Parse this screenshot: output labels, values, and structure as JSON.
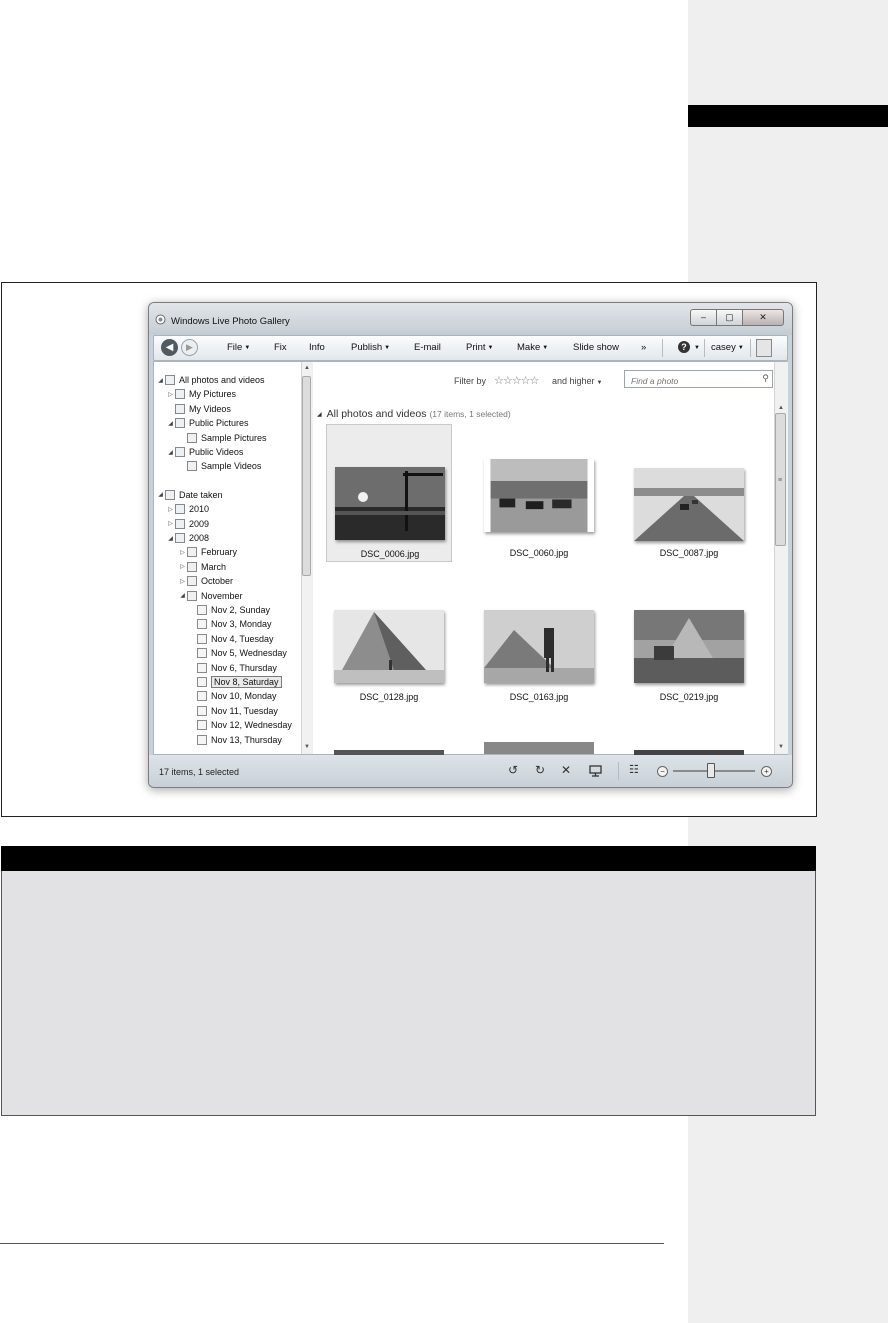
{
  "window": {
    "title": "Windows Live Photo Gallery",
    "controls": [
      "–",
      "▢",
      "✕"
    ]
  },
  "toolbar": {
    "menus": [
      {
        "label": "File",
        "dropdown": true
      },
      {
        "label": "Fix",
        "dropdown": false
      },
      {
        "label": "Info",
        "dropdown": false
      },
      {
        "label": "Publish",
        "dropdown": true
      },
      {
        "label": "E-mail",
        "dropdown": false
      },
      {
        "label": "Print",
        "dropdown": true
      },
      {
        "label": "Make",
        "dropdown": true
      },
      {
        "label": "Slide show",
        "dropdown": false
      }
    ],
    "overflow_label": "»",
    "help_label": "?",
    "user_label": "casey"
  },
  "nav_tree": {
    "items": [
      {
        "label": "All photos and videos",
        "level": 0,
        "toggle": "expanded",
        "icon": "library-icon"
      },
      {
        "label": "My Pictures",
        "level": 1,
        "toggle": "collapsed",
        "icon": "folder-icon"
      },
      {
        "label": "My Videos",
        "level": 1,
        "toggle": "none",
        "icon": "folder-icon"
      },
      {
        "label": "Public Pictures",
        "level": 1,
        "toggle": "expanded",
        "icon": "folder-icon"
      },
      {
        "label": "Sample Pictures",
        "level": 2,
        "toggle": "none",
        "icon": "folder-icon"
      },
      {
        "label": "Public Videos",
        "level": 1,
        "toggle": "expanded",
        "icon": "folder-icon"
      },
      {
        "label": "Sample Videos",
        "level": 2,
        "toggle": "none",
        "icon": "folder-icon"
      },
      {
        "label": "Date taken",
        "level": 0,
        "toggle": "expanded",
        "icon": "calendar-icon",
        "gap": true
      },
      {
        "label": "2010",
        "level": 1,
        "toggle": "collapsed",
        "icon": "calendar-icon"
      },
      {
        "label": "2009",
        "level": 1,
        "toggle": "collapsed",
        "icon": "calendar-icon"
      },
      {
        "label": "2008",
        "level": 1,
        "toggle": "expanded",
        "icon": "calendar-icon"
      },
      {
        "label": "February",
        "level": 2,
        "toggle": "collapsed",
        "icon": "calendar-icon"
      },
      {
        "label": "March",
        "level": 2,
        "toggle": "collapsed",
        "icon": "calendar-icon"
      },
      {
        "label": "October",
        "level": 2,
        "toggle": "collapsed",
        "icon": "calendar-icon"
      },
      {
        "label": "November",
        "level": 2,
        "toggle": "expanded",
        "icon": "calendar-icon"
      },
      {
        "label": "Nov 2, Sunday",
        "level": 3,
        "toggle": "none",
        "icon": "day-icon"
      },
      {
        "label": "Nov 3, Monday",
        "level": 3,
        "toggle": "none",
        "icon": "day-icon"
      },
      {
        "label": "Nov 4, Tuesday",
        "level": 3,
        "toggle": "none",
        "icon": "day-icon"
      },
      {
        "label": "Nov 5, Wednesday",
        "level": 3,
        "toggle": "none",
        "icon": "day-icon"
      },
      {
        "label": "Nov 6, Thursday",
        "level": 3,
        "toggle": "none",
        "icon": "day-icon"
      },
      {
        "label": "Nov 8, Saturday",
        "level": 3,
        "toggle": "none",
        "icon": "day-icon",
        "selected": true
      },
      {
        "label": "Nov 10, Monday",
        "level": 3,
        "toggle": "none",
        "icon": "day-icon"
      },
      {
        "label": "Nov 11, Tuesday",
        "level": 3,
        "toggle": "none",
        "icon": "day-icon"
      },
      {
        "label": "Nov 12, Wednesday",
        "level": 3,
        "toggle": "none",
        "icon": "day-icon"
      },
      {
        "label": "Nov 13, Thursday",
        "level": 3,
        "toggle": "none",
        "icon": "day-icon"
      }
    ]
  },
  "filter": {
    "label": "Filter by",
    "stars": "☆☆☆☆☆",
    "higher_label": "and higher"
  },
  "search": {
    "placeholder": "Find a photo"
  },
  "gallery": {
    "group_title": "All photos and videos",
    "group_count": "(17 items, 1 selected)",
    "photos": [
      {
        "name": "DSC_0006.jpg",
        "selected": true,
        "scene": "sunset-crane"
      },
      {
        "name": "DSC_0060.jpg",
        "selected": false,
        "scene": "cattle-field"
      },
      {
        "name": "DSC_0087.jpg",
        "selected": false,
        "scene": "highway"
      },
      {
        "name": "DSC_0128.jpg",
        "selected": false,
        "scene": "pyramid"
      },
      {
        "name": "DSC_0163.jpg",
        "selected": false,
        "scene": "pyramid-person"
      },
      {
        "name": "DSC_0219.jpg",
        "selected": false,
        "scene": "sphinx"
      }
    ]
  },
  "statusbar": {
    "text": "17 items, 1 selected",
    "zoom_level": 0.45
  },
  "colors": {
    "accent": "#000000",
    "window_frame": "#c9d2da",
    "selection": "#ececec"
  }
}
